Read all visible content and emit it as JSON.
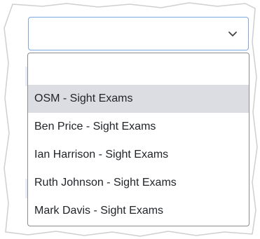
{
  "select": {
    "value": "",
    "chevron_icon": "chevron-down-icon"
  },
  "dropdown": {
    "options": [
      {
        "label": "",
        "highlighted": false
      },
      {
        "label": "OSM - Sight Exams",
        "highlighted": true
      },
      {
        "label": "Ben Price - Sight Exams",
        "highlighted": false
      },
      {
        "label": "Ian Harrison - Sight Exams",
        "highlighted": false
      },
      {
        "label": "Ruth Johnson - Sight Exams",
        "highlighted": false
      },
      {
        "label": "Mark Davis - Sight Exams",
        "highlighted": false
      }
    ]
  },
  "colors": {
    "select_border": "#7ea6df",
    "highlight": "#dcdde2",
    "dropdown_border": "#8c8c8c"
  }
}
